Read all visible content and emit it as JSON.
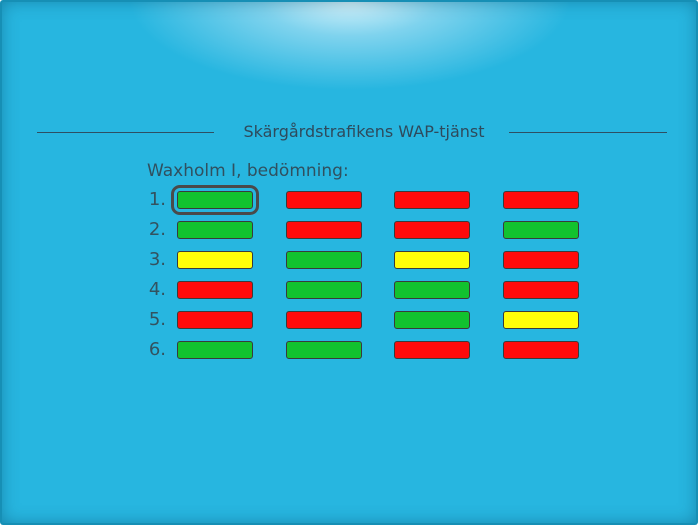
{
  "header": {
    "title": "Skärgårdstrafikens WAP-tjänst"
  },
  "subtitle": "Waxholm I, bedömning:",
  "colors": {
    "green": "#12c22f",
    "red": "#ff0a0a",
    "yellow": "#ffff08",
    "background": "#27b6e0"
  },
  "grid": {
    "selected": {
      "row": 0,
      "col": 0
    },
    "rows": [
      {
        "label": "1.",
        "cells": [
          "green",
          "red",
          "red",
          "red"
        ]
      },
      {
        "label": "2.",
        "cells": [
          "green",
          "red",
          "red",
          "green"
        ]
      },
      {
        "label": "3.",
        "cells": [
          "yellow",
          "green",
          "yellow",
          "red"
        ]
      },
      {
        "label": "4.",
        "cells": [
          "red",
          "green",
          "green",
          "red"
        ]
      },
      {
        "label": "5.",
        "cells": [
          "red",
          "red",
          "green",
          "yellow"
        ]
      },
      {
        "label": "6.",
        "cells": [
          "green",
          "green",
          "red",
          "red"
        ]
      }
    ]
  }
}
